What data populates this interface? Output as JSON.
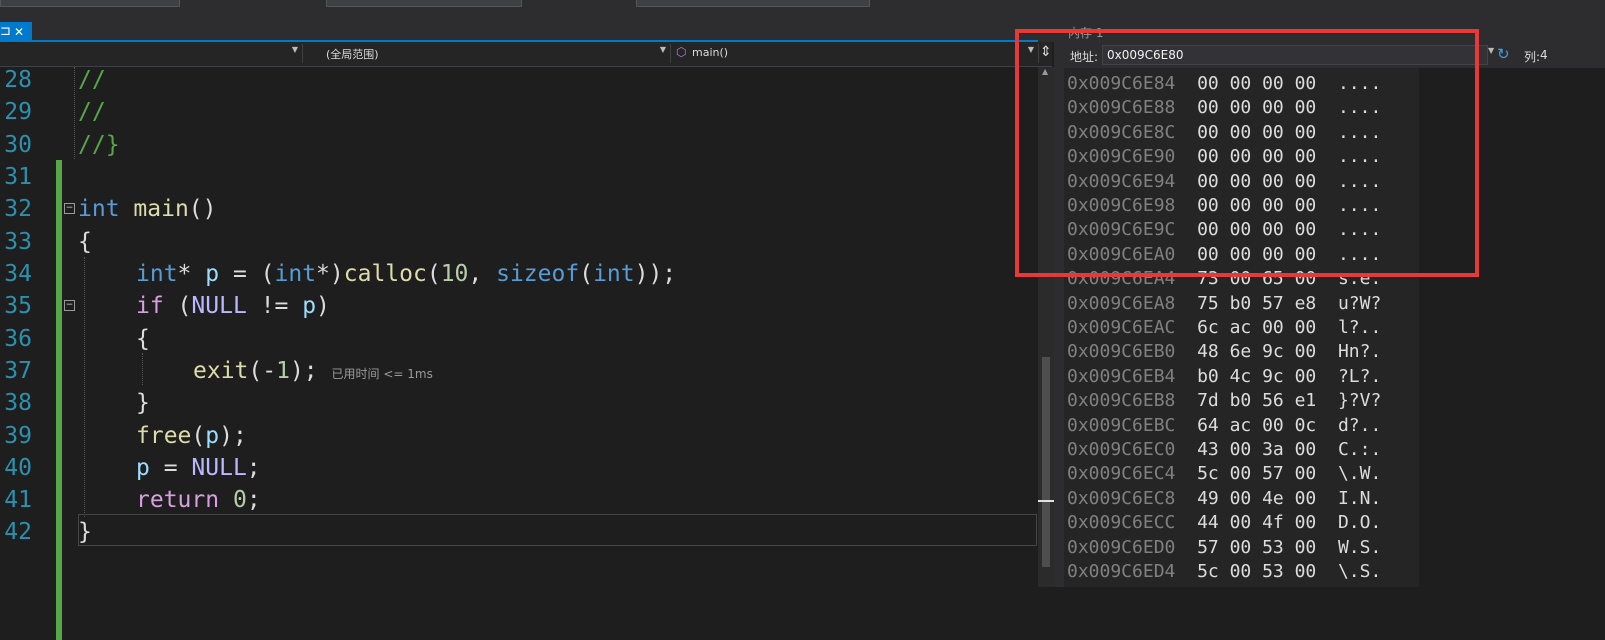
{
  "editor": {
    "tab_glyph": "⊐",
    "tab_close": "✕",
    "nav": {
      "scope": "(全局范围)",
      "function": "main()",
      "function_icon": "cube-icon"
    },
    "lines": [
      {
        "num": "28"
      },
      {
        "num": "29"
      },
      {
        "num": "30"
      },
      {
        "num": "31"
      },
      {
        "num": "32"
      },
      {
        "num": "33"
      },
      {
        "num": "34"
      },
      {
        "num": "35"
      },
      {
        "num": "36"
      },
      {
        "num": "37"
      },
      {
        "num": "38"
      },
      {
        "num": "39"
      },
      {
        "num": "40"
      },
      {
        "num": "41"
      },
      {
        "num": "42"
      }
    ],
    "code": {
      "c28": "//",
      "c29": "//",
      "c30": "//}",
      "c32_kw": "int",
      "c32_fn": "main",
      "c32_rest": "()",
      "c33": "{",
      "c34_kw1": "int",
      "c34_a": "* ",
      "c34_var": "p",
      "c34_b": " = (",
      "c34_kw2": "int",
      "c34_c": "*)",
      "c34_fn": "calloc",
      "c34_d": "(",
      "c34_num": "10",
      "c34_e": ", ",
      "c34_kw3": "sizeof",
      "c34_f": "(",
      "c34_kw4": "int",
      "c34_g": "));",
      "c35_ctl": "if",
      "c35_a": " (",
      "c35_mac": "NULL",
      "c35_b": " != ",
      "c35_var": "p",
      "c35_c": ")",
      "c36": "{",
      "c37_fn": "exit",
      "c37_a": "(-",
      "c37_num": "1",
      "c37_b": ");",
      "c37_hint": "已用时间 <= 1ms",
      "c38": "}",
      "c39_fn": "free",
      "c39_a": "(",
      "c39_var": "p",
      "c39_b": ");",
      "c40_var": "p",
      "c40_a": " = ",
      "c40_mac": "NULL",
      "c40_b": ";",
      "c41_ctl": "return",
      "c41_a": " ",
      "c41_num": "0",
      "c41_b": ";",
      "c42": "}"
    }
  },
  "memory": {
    "title_partial": "内存 1",
    "address_label": "地址:",
    "address_value": "0x009C6E80",
    "columns_label": "列:",
    "columns_value": "4",
    "rows": [
      {
        "addr": "0x009C6E84",
        "bytes": "00 00 00 00",
        "ascii": "...."
      },
      {
        "addr": "0x009C6E88",
        "bytes": "00 00 00 00",
        "ascii": "...."
      },
      {
        "addr": "0x009C6E8C",
        "bytes": "00 00 00 00",
        "ascii": "...."
      },
      {
        "addr": "0x009C6E90",
        "bytes": "00 00 00 00",
        "ascii": "...."
      },
      {
        "addr": "0x009C6E94",
        "bytes": "00 00 00 00",
        "ascii": "...."
      },
      {
        "addr": "0x009C6E98",
        "bytes": "00 00 00 00",
        "ascii": "...."
      },
      {
        "addr": "0x009C6E9C",
        "bytes": "00 00 00 00",
        "ascii": "...."
      },
      {
        "addr": "0x009C6EA0",
        "bytes": "00 00 00 00",
        "ascii": "...."
      },
      {
        "addr": "0x009C6EA4",
        "bytes": "73 00 65 00",
        "ascii": "s.e."
      },
      {
        "addr": "0x009C6EA8",
        "bytes": "75 b0 57 e8",
        "ascii": "u?W?"
      },
      {
        "addr": "0x009C6EAC",
        "bytes": "6c ac 00 00",
        "ascii": "l?.."
      },
      {
        "addr": "0x009C6EB0",
        "bytes": "48 6e 9c 00",
        "ascii": "Hn?."
      },
      {
        "addr": "0x009C6EB4",
        "bytes": "b0 4c 9c 00",
        "ascii": "?L?."
      },
      {
        "addr": "0x009C6EB8",
        "bytes": "7d b0 56 e1",
        "ascii": "}?V?"
      },
      {
        "addr": "0x009C6EBC",
        "bytes": "64 ac 00 0c",
        "ascii": "d?.."
      },
      {
        "addr": "0x009C6EC0",
        "bytes": "43 00 3a 00",
        "ascii": "C.:."
      },
      {
        "addr": "0x009C6EC4",
        "bytes": "5c 00 57 00",
        "ascii": "\\.W."
      },
      {
        "addr": "0x009C6EC8",
        "bytes": "49 00 4e 00",
        "ascii": "I.N."
      },
      {
        "addr": "0x009C6ECC",
        "bytes": "44 00 4f 00",
        "ascii": "D.O."
      },
      {
        "addr": "0x009C6ED0",
        "bytes": "57 00 53 00",
        "ascii": "W.S."
      },
      {
        "addr": "0x009C6ED4",
        "bytes": "5c 00 53 00",
        "ascii": "\\.S."
      }
    ]
  },
  "colors": {
    "accent": "#007acc",
    "highlight": "#e83838"
  }
}
